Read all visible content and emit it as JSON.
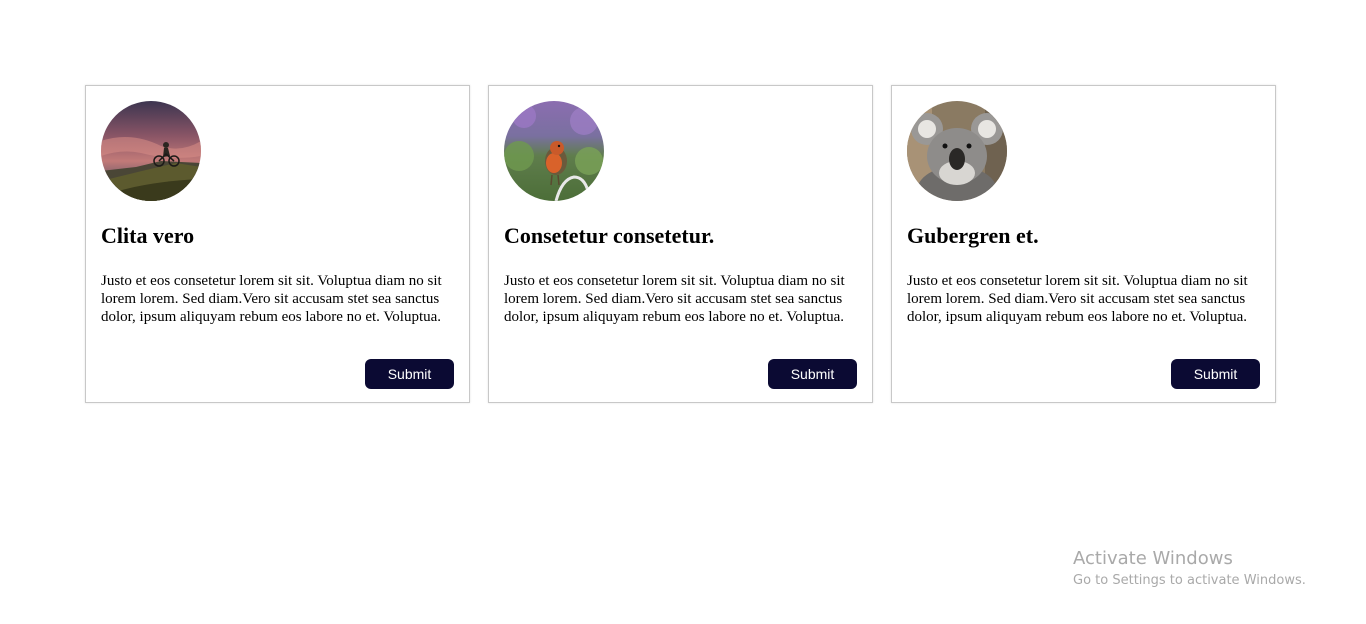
{
  "cards": [
    {
      "image": "mountain-biker-sunset-photo",
      "title": "Clita vero",
      "body": "Justo et eos consetetur lorem sit sit. Voluptua diam no sit lorem lorem. Sed diam.Vero sit accusam stet sea sanctus dolor, ipsum aliquyam rebum eos labore no et. Voluptua.",
      "button_label": "Submit"
    },
    {
      "image": "robin-bird-photo",
      "title": "Consetetur consetetur.",
      "body": "Justo et eos consetetur lorem sit sit. Voluptua diam no sit lorem lorem. Sed diam.Vero sit accusam stet sea sanctus dolor, ipsum aliquyam rebum eos labore no et. Voluptua.",
      "button_label": "Submit"
    },
    {
      "image": "koala-photo",
      "title": "Gubergren et.",
      "body": "Justo et eos consetetur lorem sit sit. Voluptua diam no sit lorem lorem. Sed diam.Vero sit accusam stet sea sanctus dolor, ipsum aliquyam rebum eos labore no et. Voluptua.",
      "button_label": "Submit"
    }
  ],
  "watermark": {
    "title": "Activate Windows",
    "subtitle": "Go to Settings to activate Windows."
  },
  "colors": {
    "button_bg": "#0b0a33",
    "button_text": "#ffffff",
    "card_border": "#c8c8c8",
    "watermark_text": "#a9a9a9"
  }
}
